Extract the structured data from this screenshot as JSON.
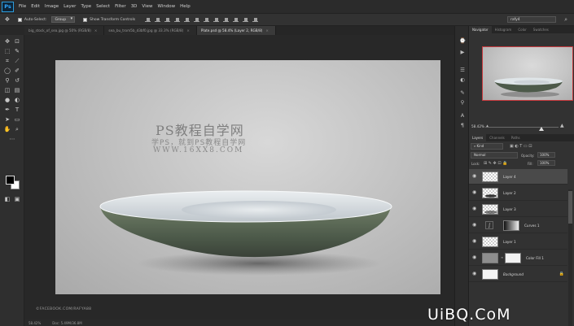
{
  "app": {
    "logo": "Ps"
  },
  "menu": [
    "File",
    "Edit",
    "Image",
    "Layer",
    "Type",
    "Select",
    "Filter",
    "3D",
    "View",
    "Window",
    "Help"
  ],
  "options": {
    "auto_select_label": "Auto-Select:",
    "auto_select_value": "Group",
    "show_transform_label": "Show Transform Controls",
    "workspace_value": "rafy4"
  },
  "doc_tabs": [
    {
      "label": "big_stock_of_sea.jpg @ 50% (RGB/8)",
      "active": false
    },
    {
      "label": "sea_bu_trom5b_d3bf0.jpg @ 33.3% (RGB/8)",
      "active": false
    },
    {
      "label": "Plate.psd @ 58.4% (Layer 2, RGB/8)",
      "active": true
    }
  ],
  "canvas": {
    "watermark_title": "PS教程自学网",
    "watermark_sub": "学PS，就到PS教程自学网",
    "watermark_url": "WWW.16XX8.COM",
    "credit": "©FACEBOOK.COM/RAFYA88"
  },
  "status": {
    "zoom": "58.42%",
    "doc_size": "Doc: 5.49M/36.8M"
  },
  "navigator": {
    "tabs": [
      "Navigator",
      "Histogram",
      "Color",
      "Swatches"
    ],
    "zoom": "58.42%"
  },
  "layers_panel": {
    "tabs": [
      "Layers",
      "Channels",
      "Paths"
    ],
    "filter_kind": "Kind",
    "blend_mode": "Normal",
    "opacity_label": "Opacity:",
    "opacity_value": "100%",
    "lock_label": "Lock:",
    "fill_label": "Fill:",
    "fill_value": "100%",
    "layers": [
      {
        "name": "Layer 4",
        "visible": true,
        "thumb": "transparent",
        "active": true
      },
      {
        "name": "Layer 2",
        "visible": true,
        "thumb": "transparent",
        "active": false
      },
      {
        "name": "Layer 3",
        "visible": true,
        "thumb": "transparent",
        "active": false
      },
      {
        "name": "Curves 1",
        "visible": true,
        "thumb": "adjustment",
        "active": false
      },
      {
        "name": "Layer 1",
        "visible": true,
        "thumb": "transparent",
        "active": false
      },
      {
        "name": "Color Fill 1",
        "visible": true,
        "thumb": "fill",
        "active": false
      },
      {
        "name": "Background",
        "visible": true,
        "thumb": "white",
        "active": false,
        "locked": true
      }
    ]
  },
  "colors": {
    "foreground": "#000000",
    "background": "#ffffff",
    "nav_frame": "#c7393d",
    "ps_blue": "#31a8ff"
  },
  "site_watermark": "UiBQ.CoM"
}
